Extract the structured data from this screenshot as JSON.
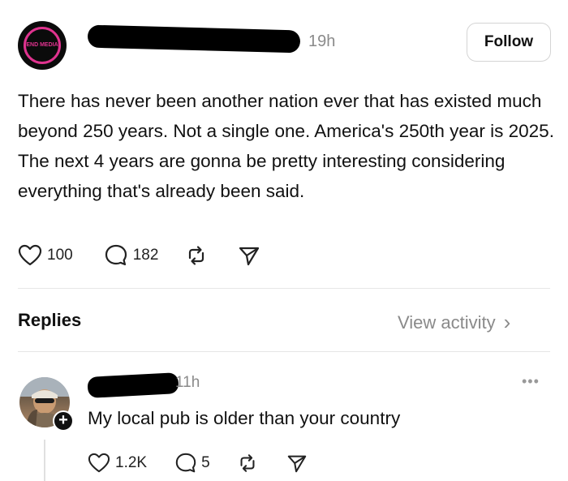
{
  "post": {
    "avatar_label": "END MEDIA",
    "time": "19h",
    "follow_label": "Follow",
    "text": "There has never been another nation ever that has existed much beyond 250 years. Not a single one. America's 250th year is 2025. The next 4 years are gonna be pretty interesting considering everything that's already been said.",
    "likes": "100",
    "comments": "182"
  },
  "replies_section": {
    "title": "Replies",
    "view_activity": "View activity",
    "chevron": "›"
  },
  "reply": {
    "time": "11h",
    "more": "•••",
    "text": "My local pub is older than your country",
    "likes": "1.2K",
    "comments": "5"
  },
  "icons": {
    "like": "heart-icon",
    "comment": "comment-bubble-icon",
    "repost": "repost-icon",
    "share": "send-icon",
    "add": "plus-icon"
  }
}
